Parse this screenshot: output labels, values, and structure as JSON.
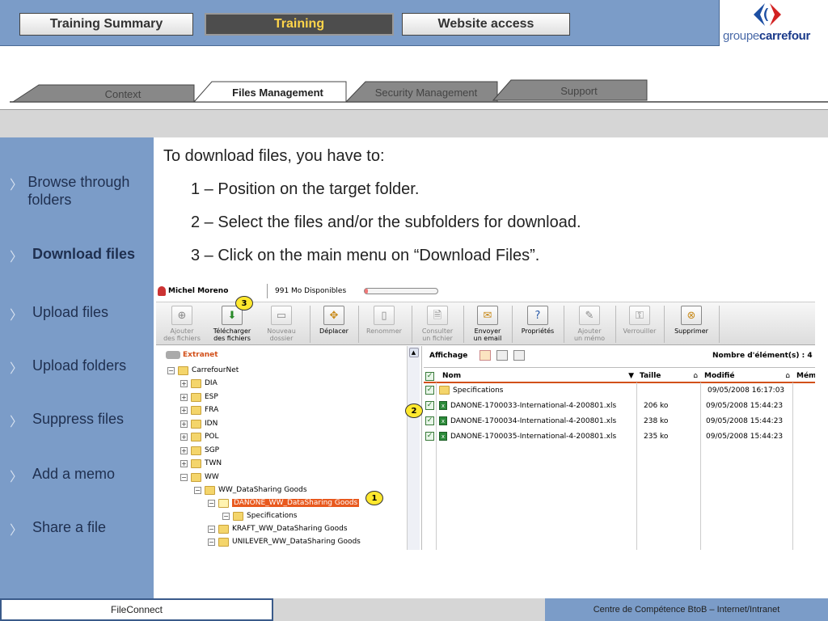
{
  "top_nav": {
    "buttons": [
      "Training Summary",
      "Training",
      "Website access"
    ],
    "active": "Training"
  },
  "logo": {
    "prefix": "groupe",
    "brand": "carrefour"
  },
  "sub_tabs": [
    "Context",
    "Files Management",
    "Security Management",
    "Support"
  ],
  "sub_tabs_active": "Files Management",
  "sidebar": {
    "items": [
      {
        "label": "Browse through folders"
      },
      {
        "label": "Download files",
        "active": true
      },
      {
        "label": "Upload files"
      },
      {
        "label": "Upload folders"
      },
      {
        "label": "Suppress files"
      },
      {
        "label": "Add a memo"
      },
      {
        "label": "Share a file"
      }
    ]
  },
  "instructions": {
    "intro": "To download files, you have to:",
    "step1": "1 – Position on the target folder.",
    "step2": "2 – Select the files and/or the subfolders for download.",
    "step3": "3 – Click on the main menu on “Download Files”."
  },
  "app": {
    "user": "Michel Moreno",
    "quota": "991 Mo Disponibles",
    "toolbar": [
      {
        "l1": "Ajouter",
        "l2": "des fichiers",
        "icon": "add-files-icon",
        "enabled": false
      },
      {
        "l1": "Télécharger",
        "l2": "des fichiers",
        "icon": "download-icon",
        "enabled": true
      },
      {
        "l1": "Nouveau",
        "l2": "dossier",
        "icon": "new-folder-icon",
        "enabled": false
      },
      {
        "l1": "Déplacer",
        "l2": "",
        "icon": "move-icon",
        "enabled": true
      },
      {
        "l1": "Renommer",
        "l2": "",
        "icon": "rename-icon",
        "enabled": false
      },
      {
        "l1": "Consulter",
        "l2": "un fichier",
        "icon": "view-file-icon",
        "enabled": false
      },
      {
        "l1": "Envoyer",
        "l2": "un email",
        "icon": "email-icon",
        "enabled": true
      },
      {
        "l1": "Propriétés",
        "l2": "",
        "icon": "properties-icon",
        "enabled": true
      },
      {
        "l1": "Ajouter",
        "l2": "un mémo",
        "icon": "memo-icon",
        "enabled": false
      },
      {
        "l1": "Verrouiller",
        "l2": "",
        "icon": "lock-icon",
        "enabled": false
      },
      {
        "l1": "Supprimer",
        "l2": "",
        "icon": "delete-icon",
        "enabled": true
      }
    ],
    "tree": {
      "root": "Extranet",
      "nodes": [
        "CarrefourNet",
        "DIA",
        "ESP",
        "FRA",
        "IDN",
        "POL",
        "SGP",
        "TWN",
        "WW",
        "WW_DataSharing Goods",
        "DANONE_WW_DataSharing Goods",
        "Specifications",
        "KRAFT_WW_DataSharing Goods",
        "UNILEVER_WW_DataSharing Goods"
      ]
    },
    "list": {
      "view_label": "Affichage",
      "count_label": "Nombre d'élément(s) : 4",
      "columns": [
        "Nom",
        "Taille",
        "Modifié",
        "Mém"
      ],
      "rows": [
        {
          "name": "Specifications",
          "size": "",
          "modified": "09/05/2008 16:17:03",
          "type": "folder"
        },
        {
          "name": "DANONE-1700033-International-4-200801.xls",
          "size": "206 ko",
          "modified": "09/05/2008 15:44:23",
          "type": "xls"
        },
        {
          "name": "DANONE-1700034-International-4-200801.xls",
          "size": "238 ko",
          "modified": "09/05/2008 15:44:23",
          "type": "xls"
        },
        {
          "name": "DANONE-1700035-International-4-200801.xls",
          "size": "235 ko",
          "modified": "09/05/2008 15:44:23",
          "type": "xls"
        }
      ]
    },
    "callouts": [
      "1",
      "2",
      "3"
    ]
  },
  "footer": {
    "left": "FileConnect",
    "right": "Centre de Compétence BtoB – Internet/Intranet"
  }
}
